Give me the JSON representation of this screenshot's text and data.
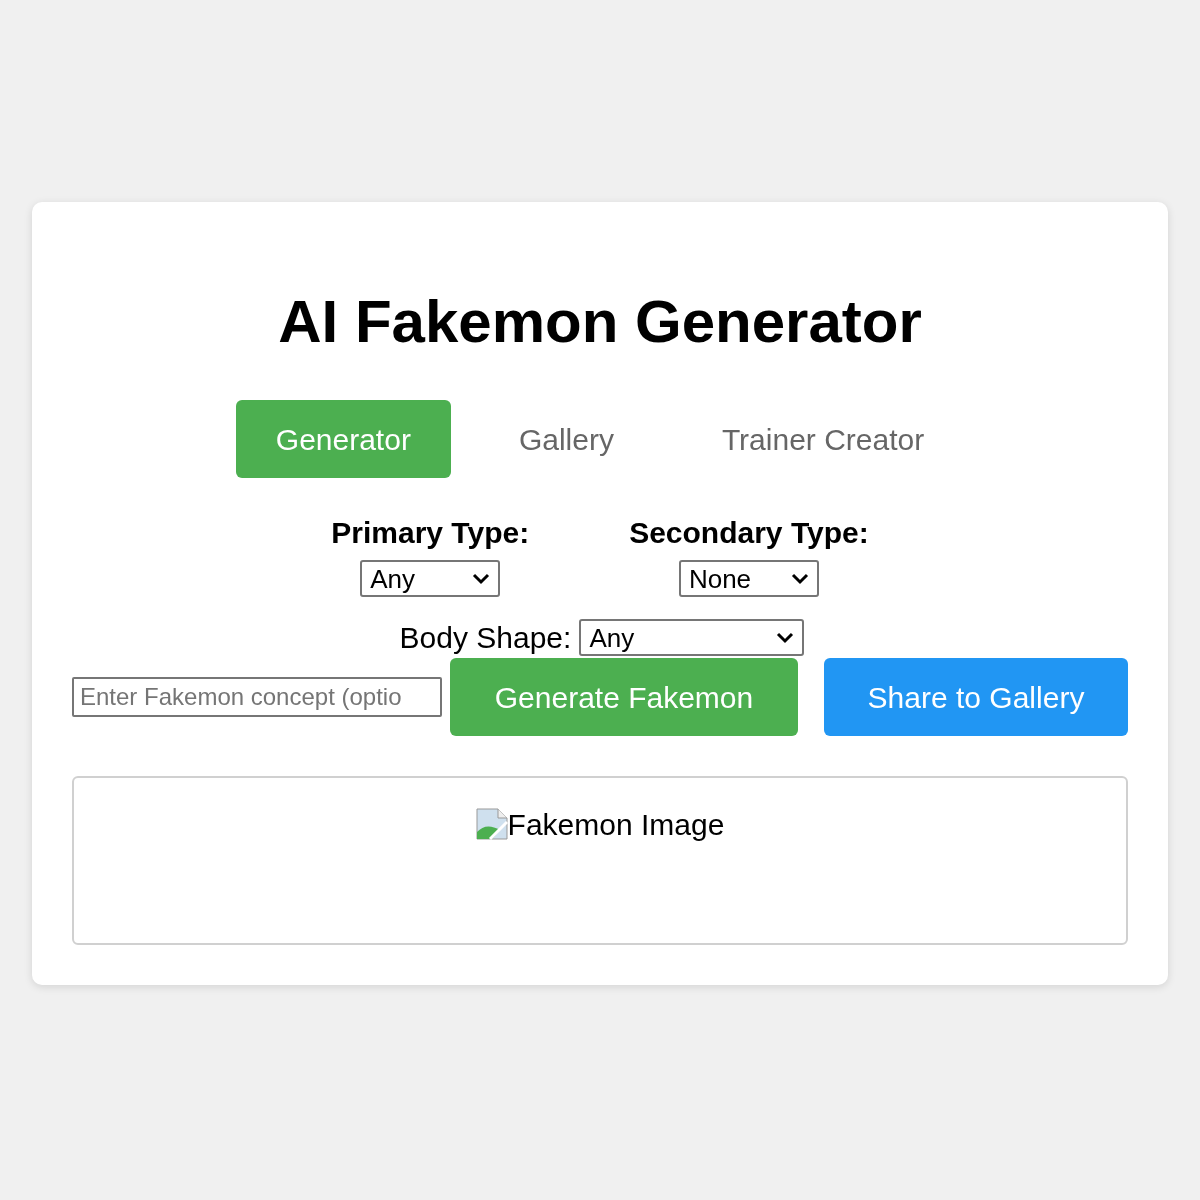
{
  "title": "AI Fakemon Generator",
  "tabs": [
    {
      "label": "Generator",
      "selected": true
    },
    {
      "label": "Gallery",
      "selected": false
    },
    {
      "label": "Trainer Creator",
      "selected": false
    }
  ],
  "type_selects": [
    {
      "label": "Primary Type:",
      "value": "Any"
    },
    {
      "label": "Secondary Type:",
      "value": "None"
    }
  ],
  "body_shape": {
    "label": "Body Shape:",
    "value": "Any"
  },
  "concept_input": {
    "placeholder": "Enter Fakemon concept (optio"
  },
  "buttons": [
    {
      "label": "Generate Fakemon",
      "color": "#4caf50"
    },
    {
      "label": "Share to Gallery",
      "color": "#2196f3"
    }
  ],
  "image_result": {
    "alt": "Fakemon Image"
  }
}
